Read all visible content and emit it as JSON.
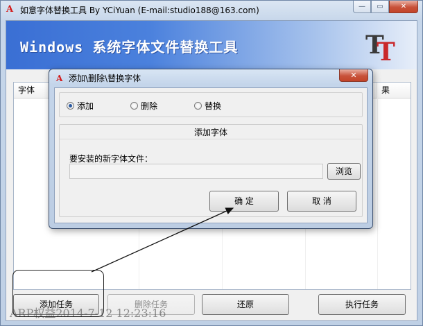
{
  "window": {
    "title": "如意字体替换工具 By YCiYuan (E-mail:studio188@163.com)",
    "icon_glyph": "A",
    "min_glyph": "—",
    "max_glyph": "▭",
    "close_glyph": "✕"
  },
  "banner": {
    "text": "Windows 系统字体文件替换工具",
    "logo_t1": "T",
    "logo_t2": "T"
  },
  "list": {
    "columns": [
      "字体",
      "",
      "",
      "",
      "",
      "",
      "",
      "",
      "果"
    ]
  },
  "buttons": {
    "add_task": "添加任务",
    "delete_task": "删除任务",
    "restore": "还原",
    "execute": "执行任务"
  },
  "watermark": "ARP权益2014-7-12 12:23:16",
  "dialog": {
    "title": "添加\\删除\\替换字体",
    "icon_glyph": "A",
    "close_glyph": "✕",
    "radios": [
      {
        "label": "添加",
        "checked": true
      },
      {
        "label": "删除",
        "checked": false
      },
      {
        "label": "替换",
        "checked": false
      }
    ],
    "group_title": "添加字体",
    "file_label": "要安装的新字体文件：",
    "file_value": "",
    "browse": "浏览",
    "ok": "确 定",
    "cancel": "取 消"
  }
}
